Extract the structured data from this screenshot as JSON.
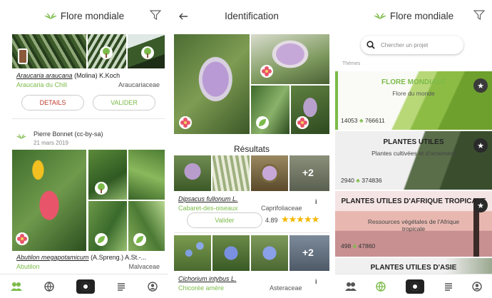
{
  "s1": {
    "title": "Flore mondiale",
    "obs1": {
      "sci_name": "Araucaria araucana",
      "author": " (Molina) K.Koch",
      "common": "Araucaria du Chili",
      "family": "Araucariaceae"
    },
    "btn_details": "DETAILS",
    "btn_valider": "VALIDER",
    "obs2": {
      "user": "Pierre Bonnet (cc-by-sa)",
      "date": "21 mars 2019",
      "sci_name": "Abutilon megapotamicum",
      "author": " (A.Spreng.) A.St.-...",
      "common": "Abutilon",
      "family": "Malvaceae"
    }
  },
  "s2": {
    "title": "Identification",
    "results_label": "Résultats",
    "more_count": "+2",
    "r1": {
      "sci_name": "Dipsacus fullonum L.",
      "common": "Cabaret-des-oiseaux",
      "family": "Caprifoliaceae",
      "info": "i",
      "btn": "Valider",
      "score": "4.89",
      "stars": "★★★★★"
    },
    "r2": {
      "sci_name": "Cichorium intybus L.",
      "common": "Chicorée amère",
      "family": "Asteraceae",
      "info": "i"
    }
  },
  "s3": {
    "title": "Flore mondiale",
    "search_placeholder": "Chercher un projet",
    "section": "Thèmes",
    "cards": [
      {
        "title": "FLORE MONDIALE",
        "subtitle": "Flore du monde",
        "count1": "14053",
        "count2": "766611"
      },
      {
        "title": "PLANTES UTILES",
        "subtitle": "Plantes cultivées et d'ornement",
        "count1": "2940",
        "count2": "374836"
      },
      {
        "title": "PLANTES UTILES D'AFRIQUE TROPICALE",
        "subtitle": "Ressources végétales de l'Afrique tropicale",
        "count1": "498",
        "count2": "47860"
      },
      {
        "title": "PLANTES UTILES D'ASIE"
      }
    ]
  },
  "colors": {
    "accent": "#7cbb4a",
    "danger": "#c0392b",
    "star": "#f5b800"
  }
}
